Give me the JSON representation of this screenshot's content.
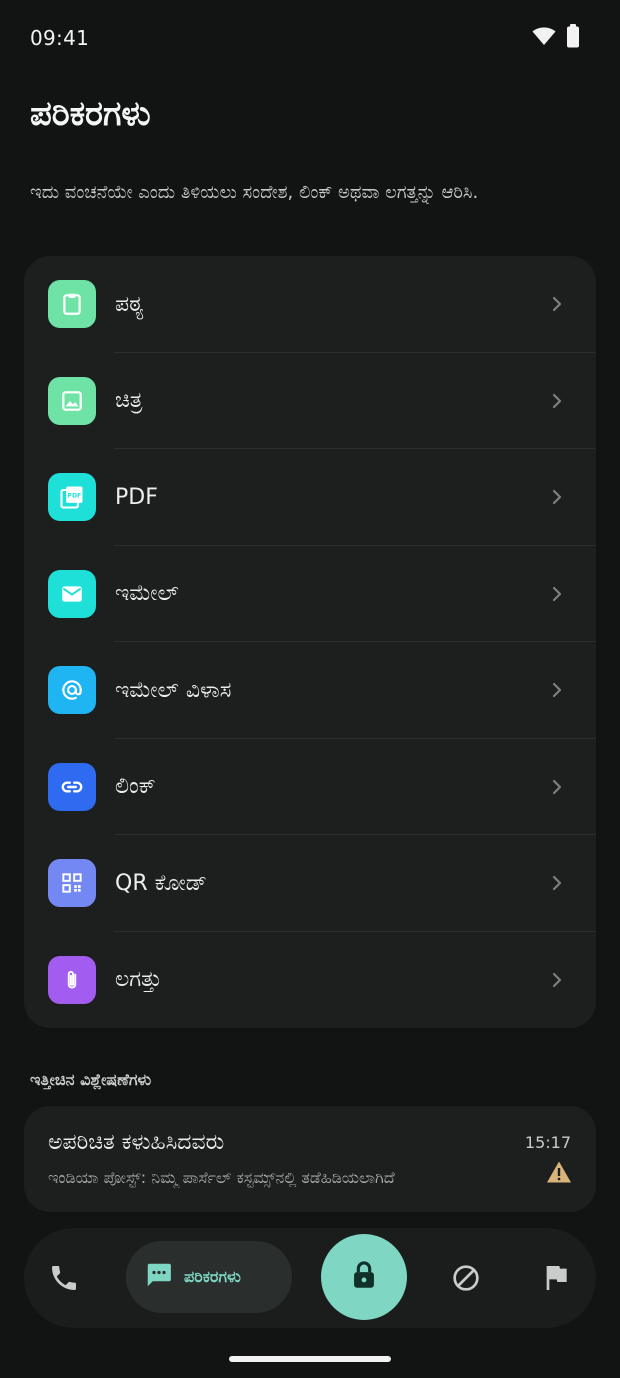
{
  "status_bar": {
    "time": "09:41"
  },
  "header": {
    "title": "ಪರಿಕರಗಳು",
    "subtitle": "ಇದು ವಂಚನೆಯೇ ಎಂದು ತಿಳಿಯಲು ಸಂದೇಶ, ಲಿಂಕ್ ಅಥವಾ ಲಗತ್ತನ್ನು ಆರಿಸಿ."
  },
  "tools": [
    {
      "label": "ಪಠ್ಯ",
      "icon": "clipboard-icon",
      "color": "#6fe3a6"
    },
    {
      "label": "ಚಿತ್ರ",
      "icon": "image-icon",
      "color": "#6fe3a6"
    },
    {
      "label": "PDF",
      "icon": "pdf-icon",
      "color": "#1ee0d8"
    },
    {
      "label": "ಇಮೇಲ್",
      "icon": "mail-icon",
      "color": "#1ee0d8"
    },
    {
      "label": "ಇಮೇಲ್ ವಿಳಾಸ",
      "icon": "at-icon",
      "color": "#1fb4f2"
    },
    {
      "label": "ಲಿಂಕ್",
      "icon": "link-icon",
      "color": "#2f6bf0"
    },
    {
      "label": "QR ಕೋಡ್",
      "icon": "qr-code-icon",
      "color": "#7388f2"
    },
    {
      "label": "ಲಗತ್ತು",
      "icon": "paperclip-icon",
      "color": "#a25cf0"
    }
  ],
  "recent": {
    "heading": "ಇತ್ತೀಚಿನ ವಿಶ್ಲೇಷಣೆಗಳು",
    "items": [
      {
        "sender": "ಅಪರಿಚಿತ ಕಳುಹಿಸಿದವರು",
        "time": "15:17",
        "preview": "ಇಂಡಿಯಾ ಪೋಸ್ಟ್: ನಿಮ್ಮ ಪಾರ್ಸೆಲ್ ಕಸ್ಟಮ್ಸ್‌ನಲ್ಲಿ ತಡೆಹಿಡಿಯಲಾಗಿದೆ",
        "status_icon": "warning-icon",
        "status_color": "#d9b37a"
      }
    ]
  },
  "bottom_nav": {
    "items": [
      {
        "icon": "phone-icon"
      },
      {
        "icon": "chat-icon",
        "label": "ಪರಿಕರಗಳು",
        "active": true
      },
      {
        "icon": "lock-icon"
      },
      {
        "icon": "block-icon"
      },
      {
        "icon": "flag-icon"
      }
    ],
    "accent": "#7fd6c2"
  }
}
